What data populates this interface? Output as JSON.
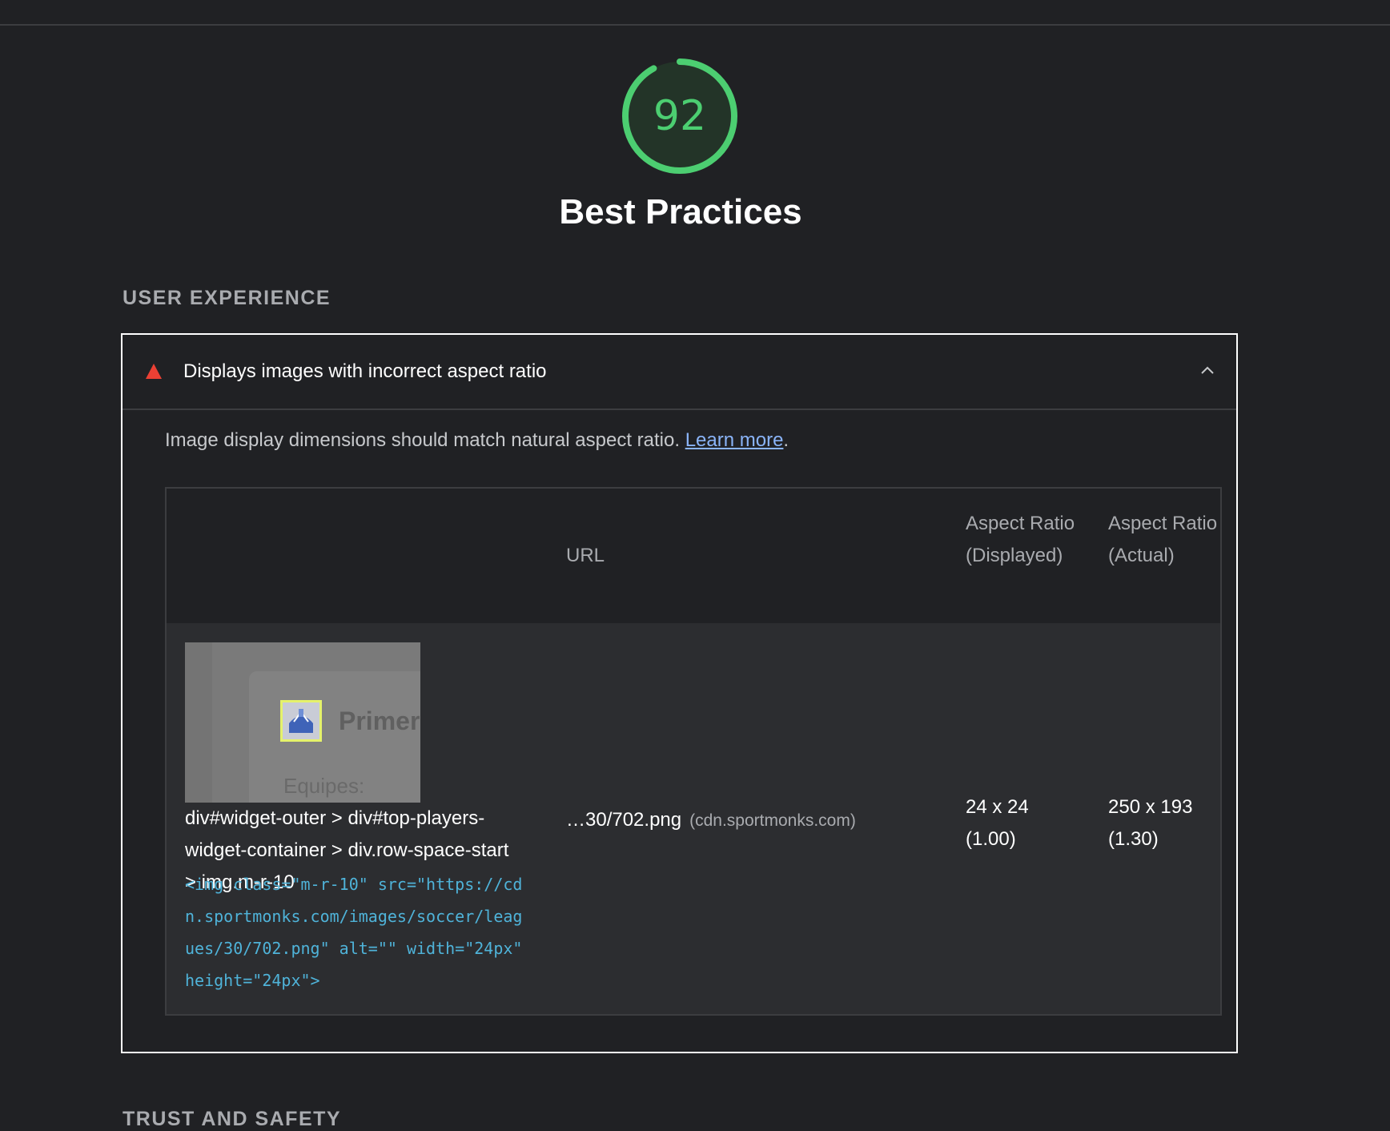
{
  "gauge": {
    "score": "92",
    "score_fraction": 0.92,
    "color": "#4cce71"
  },
  "category": {
    "title": "Best Practices"
  },
  "group": {
    "title": "USER EXPERIENCE",
    "next_title": "TRUST AND SAFETY"
  },
  "audit": {
    "title": "Displays images with incorrect aspect ratio",
    "status_icon": "warning-triangle-icon",
    "status_color": "#eb4034",
    "toggle_icon": "chevron-up-icon",
    "description": "Image display dimensions should match natural aspect ratio.",
    "learn_more": "Learn more",
    "description_end": ".",
    "table": {
      "headers": {
        "url": "URL",
        "displayed": "Aspect Ratio (Displayed)",
        "actual": "Aspect Ratio (Actual)"
      },
      "rows": [
        {
          "thumbnail_text": "Primera",
          "thumbnail_subtext": "Equipes:",
          "selector_part1": "div#widget-outer > div#top-",
          "selector_part2": "players-widget-container > div.row-space-start > img.m-r-10",
          "snippet": "<img class=\"m-r-10\" src=\"https://cdn.sportmonks.com/images/soccer/leagues/30/702.png\" alt=\"\" width=\"24px\" height=\"24px\">",
          "url": "…30/702.png",
          "url_host": "(cdn.sportmonks.com)",
          "displayed_line1": "24 x 24",
          "displayed_line2": "(1.00)",
          "actual_line1": "250 x 193",
          "actual_line2": "(1.30)"
        }
      ]
    }
  }
}
